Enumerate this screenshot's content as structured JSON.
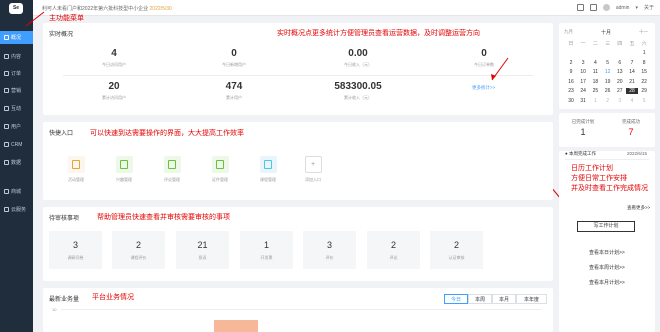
{
  "topbar": {
    "notice": "利可人未看门户和2022年第六批科技型中小企业",
    "notice_date": "2022/5/30",
    "user": "admin",
    "about": "关于"
  },
  "sidebar": {
    "logo": "Se",
    "items": [
      {
        "label": "概况",
        "active": true
      },
      {
        "label": "内容"
      },
      {
        "label": "订单"
      },
      {
        "label": "营销"
      },
      {
        "label": "互动"
      },
      {
        "label": "用户"
      },
      {
        "label": "CRM"
      },
      {
        "label": "数据"
      },
      {
        "label": "商城"
      },
      {
        "label": "云服务"
      }
    ]
  },
  "annotations": {
    "menu": "主功能菜单",
    "overview": "实时概况点更多统计方便管理员查看运营数据，及时调整运营方向",
    "quick": "可以快速到达需要操作的界面，大大提高工作效率",
    "todo": "帮助管理员快速查看并审核需要审核的事项",
    "business": "平台业务情况",
    "calendar": "日历工作计划\n方便日常工作安排\n并及时查看工作完成情况"
  },
  "overview": {
    "title": "实时概况",
    "stats": [
      {
        "value": "4",
        "label": "今日访问用户"
      },
      {
        "value": "0",
        "label": "今日新增用户"
      },
      {
        "value": "0.00",
        "label": "今日收入（元）"
      },
      {
        "value": "0",
        "label": "今日订单数"
      },
      {
        "value": "20",
        "label": "累计访问用户"
      },
      {
        "value": "474",
        "label": "累计用户"
      },
      {
        "value": "583300.05",
        "label": "累计收入（元）"
      }
    ],
    "more": "更多统计>>"
  },
  "quick_entry": {
    "title": "快捷入口",
    "items": [
      {
        "label": "活动管理",
        "color": "#f5d7a6",
        "bg": "#fdf6ec"
      },
      {
        "label": "兴趣管理",
        "color": "#67c23a",
        "bg": "#eef8e8"
      },
      {
        "label": "评论管理",
        "color": "#67c23a",
        "bg": "#eef8e8"
      },
      {
        "label": "证件管理",
        "color": "#67c23a",
        "bg": "#eef8e8"
      },
      {
        "label": "课程管理",
        "color": "#4fc3e8",
        "bg": "#e8f6fb"
      },
      {
        "label": "添加入口",
        "color": "#999",
        "bg": "#fff",
        "plus": "+"
      }
    ]
  },
  "todo": {
    "title": "待审核事项",
    "items": [
      {
        "value": "3",
        "label": "调研问卷"
      },
      {
        "value": "2",
        "label": "课程评价"
      },
      {
        "value": "21",
        "label": "投诉"
      },
      {
        "value": "1",
        "label": "开发票"
      },
      {
        "value": "3",
        "label": "评价"
      },
      {
        "value": "2",
        "label": "评论"
      },
      {
        "value": "2",
        "label": "认证审核"
      }
    ]
  },
  "business": {
    "title": "最新业务量",
    "tabs": [
      "今日",
      "本周",
      "本月",
      "本年度"
    ],
    "active_tab": "今日",
    "y_tick": "10"
  },
  "calendar": {
    "prev": "九月",
    "month": "十月",
    "next": "十一",
    "weekdays": [
      "日",
      "一",
      "二",
      "三",
      "四",
      "五",
      "六"
    ],
    "rows": [
      [
        "",
        "",
        "",
        "",
        "",
        "",
        "1"
      ],
      [
        "2",
        "3",
        "4",
        "5",
        "6",
        "7",
        "8"
      ],
      [
        "9",
        "10",
        "11",
        "12",
        "13",
        "14",
        "15"
      ],
      [
        "16",
        "17",
        "18",
        "19",
        "20",
        "21",
        "22"
      ],
      [
        "23",
        "24",
        "25",
        "26",
        "27",
        "28",
        "29"
      ],
      [
        "30",
        "31",
        "1",
        "2",
        "3",
        "4",
        "5"
      ]
    ],
    "today": "12",
    "selected": "28",
    "plan_label": "已完成计划",
    "plan_value": "1",
    "done_label": "完成成功",
    "done_value": "7",
    "note": "● 本周完成工作",
    "note_date": "2022/6/15",
    "view_more": "查看更多>>",
    "write_button": "写工作计划",
    "links": [
      "查看本日计划>>",
      "查看本周计划>>",
      "查看本月计划>>"
    ]
  }
}
